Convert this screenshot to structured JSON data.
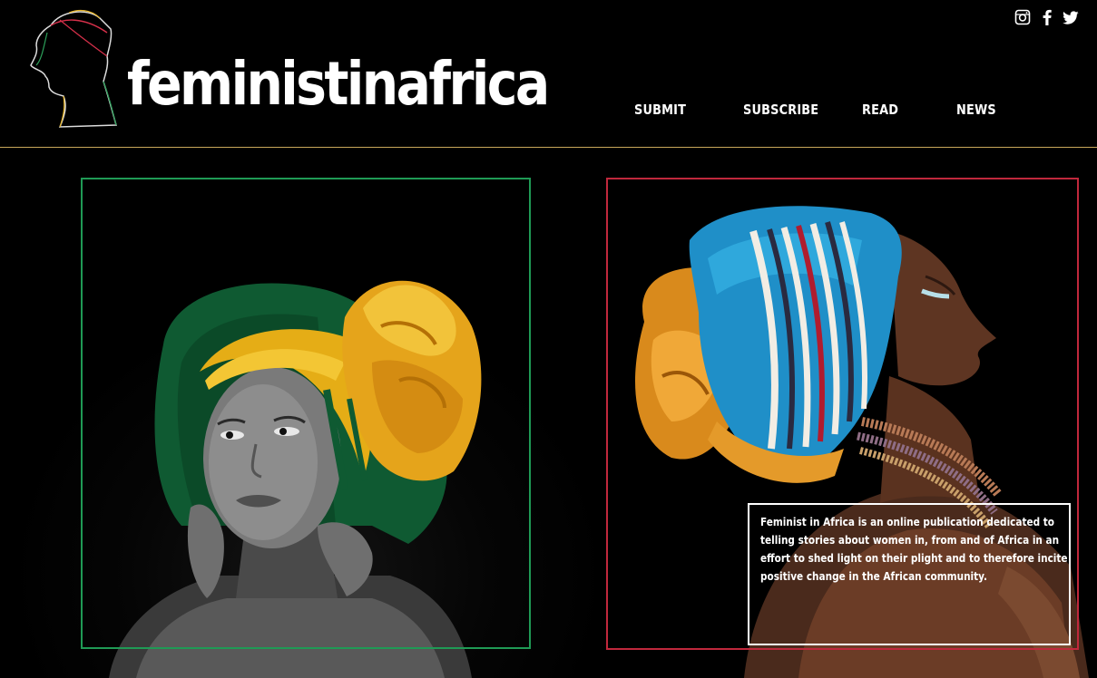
{
  "brand": {
    "name": "feministinafrica",
    "logo_icon": "woman-silhouette-logo-icon"
  },
  "social": [
    {
      "id": "instagram",
      "icon": "instagram-icon"
    },
    {
      "id": "facebook",
      "icon": "facebook-icon"
    },
    {
      "id": "twitter",
      "icon": "twitter-icon"
    }
  ],
  "nav": {
    "items": [
      {
        "label": "SUBMIT"
      },
      {
        "label": "SUBSCRIBE"
      },
      {
        "label": "READ"
      },
      {
        "label": "NEWS"
      }
    ]
  },
  "colors": {
    "background": "#000000",
    "header_rule": "#c8a75a",
    "frame_left": "#1f9a55",
    "frame_right": "#c0283c",
    "text": "#ffffff"
  },
  "hero": {
    "left_image": "woman-with-green-yellow-headwrap-photo",
    "right_image": "woman-with-blue-striped-headwrap-photo"
  },
  "about": {
    "text": "Feminist in Africa is an online publication dedicated to telling stories about women in, from and of Africa in an effort to shed light on their plight and to therefore incite positive change in the African community."
  }
}
